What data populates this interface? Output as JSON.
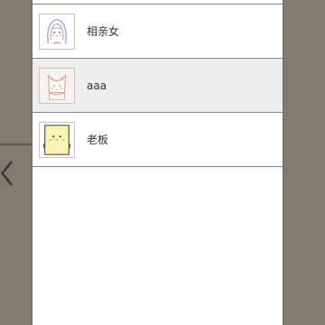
{
  "contacts": [
    {
      "name": "相亲女",
      "avatar_icon": "girl-avatar-icon",
      "selected": false
    },
    {
      "name": "aaa",
      "avatar_icon": "cat-avatar-icon",
      "selected": true
    },
    {
      "name": "老板",
      "avatar_icon": "chick-avatar-icon",
      "selected": false
    }
  ],
  "colors": {
    "background": "#817b70",
    "panel": "#ffffff",
    "selected_row": "#eeeeee",
    "divider": "#8a857d",
    "text": "#333333"
  }
}
